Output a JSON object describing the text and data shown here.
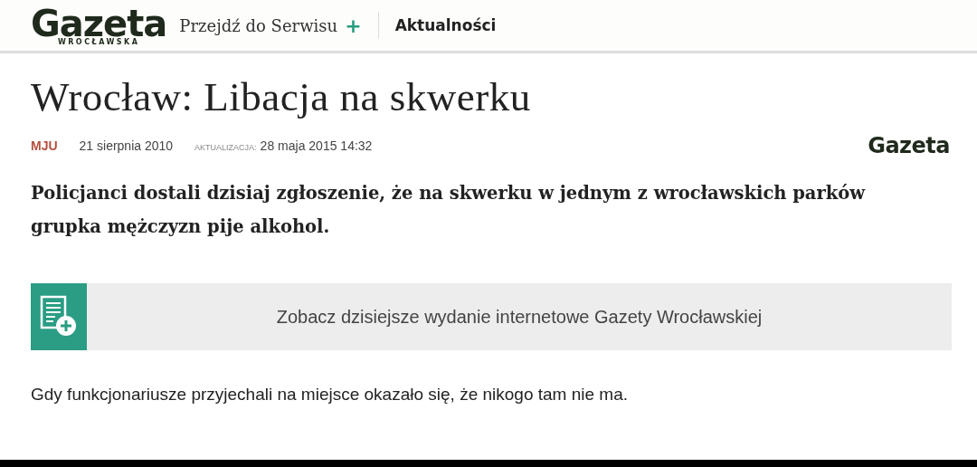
{
  "header": {
    "logo": {
      "name": "Gazeta",
      "subtitle": "WROCŁAWSKA"
    },
    "service_link": "Przejdź do Serwisu",
    "plus": "+",
    "section": "Aktualności"
  },
  "article": {
    "title": "Wrocław: Libacja na skwerku",
    "author": "MJU",
    "date": "21 sierpnia 2010",
    "updated_label": "AKTUALIZACJA:",
    "updated": "28 maja 2015 14:32",
    "source_logo": {
      "name": "Gazeta"
    },
    "lead": "Policjanci dostali dzisiaj zgłoszenie, że na skwerku w jednym z wrocławskich parków grupka mężczyzn pije alkohol.",
    "promo": "Zobacz dzisiejsze wydanie internetowe Gazety Wrocławskiej",
    "body": "Gdy funkcjonariusze przyjechali na miejsce okazało się, że nikogo tam nie ma."
  }
}
